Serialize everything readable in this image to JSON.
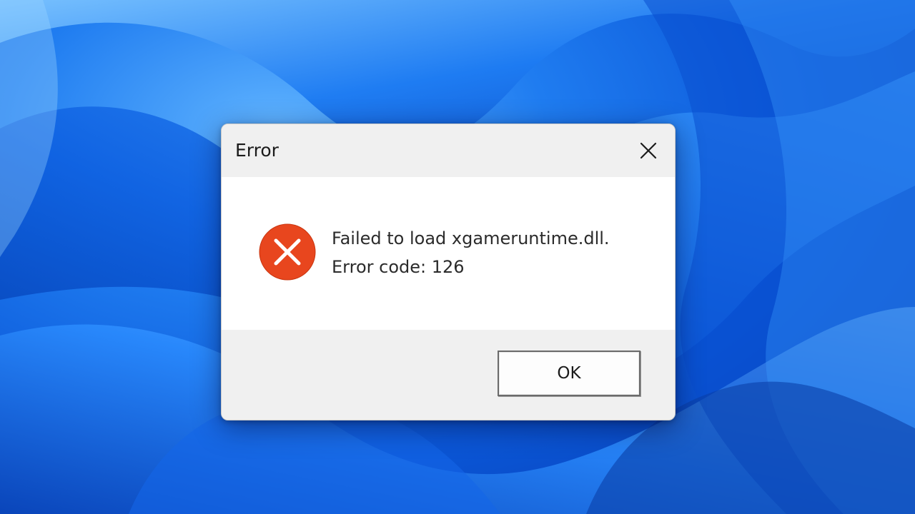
{
  "desktop": {
    "wallpaper": "windows-bloom",
    "accent_color": "#0b57d8"
  },
  "dialog": {
    "title": "Error",
    "close_icon": "close-icon",
    "error_icon": "error-x-icon",
    "error_icon_color": "#e8461e",
    "message_line_1": "Failed to load xgameruntime.dll.",
    "message_line_2": "Error code: 126",
    "ok_label": "OK"
  }
}
